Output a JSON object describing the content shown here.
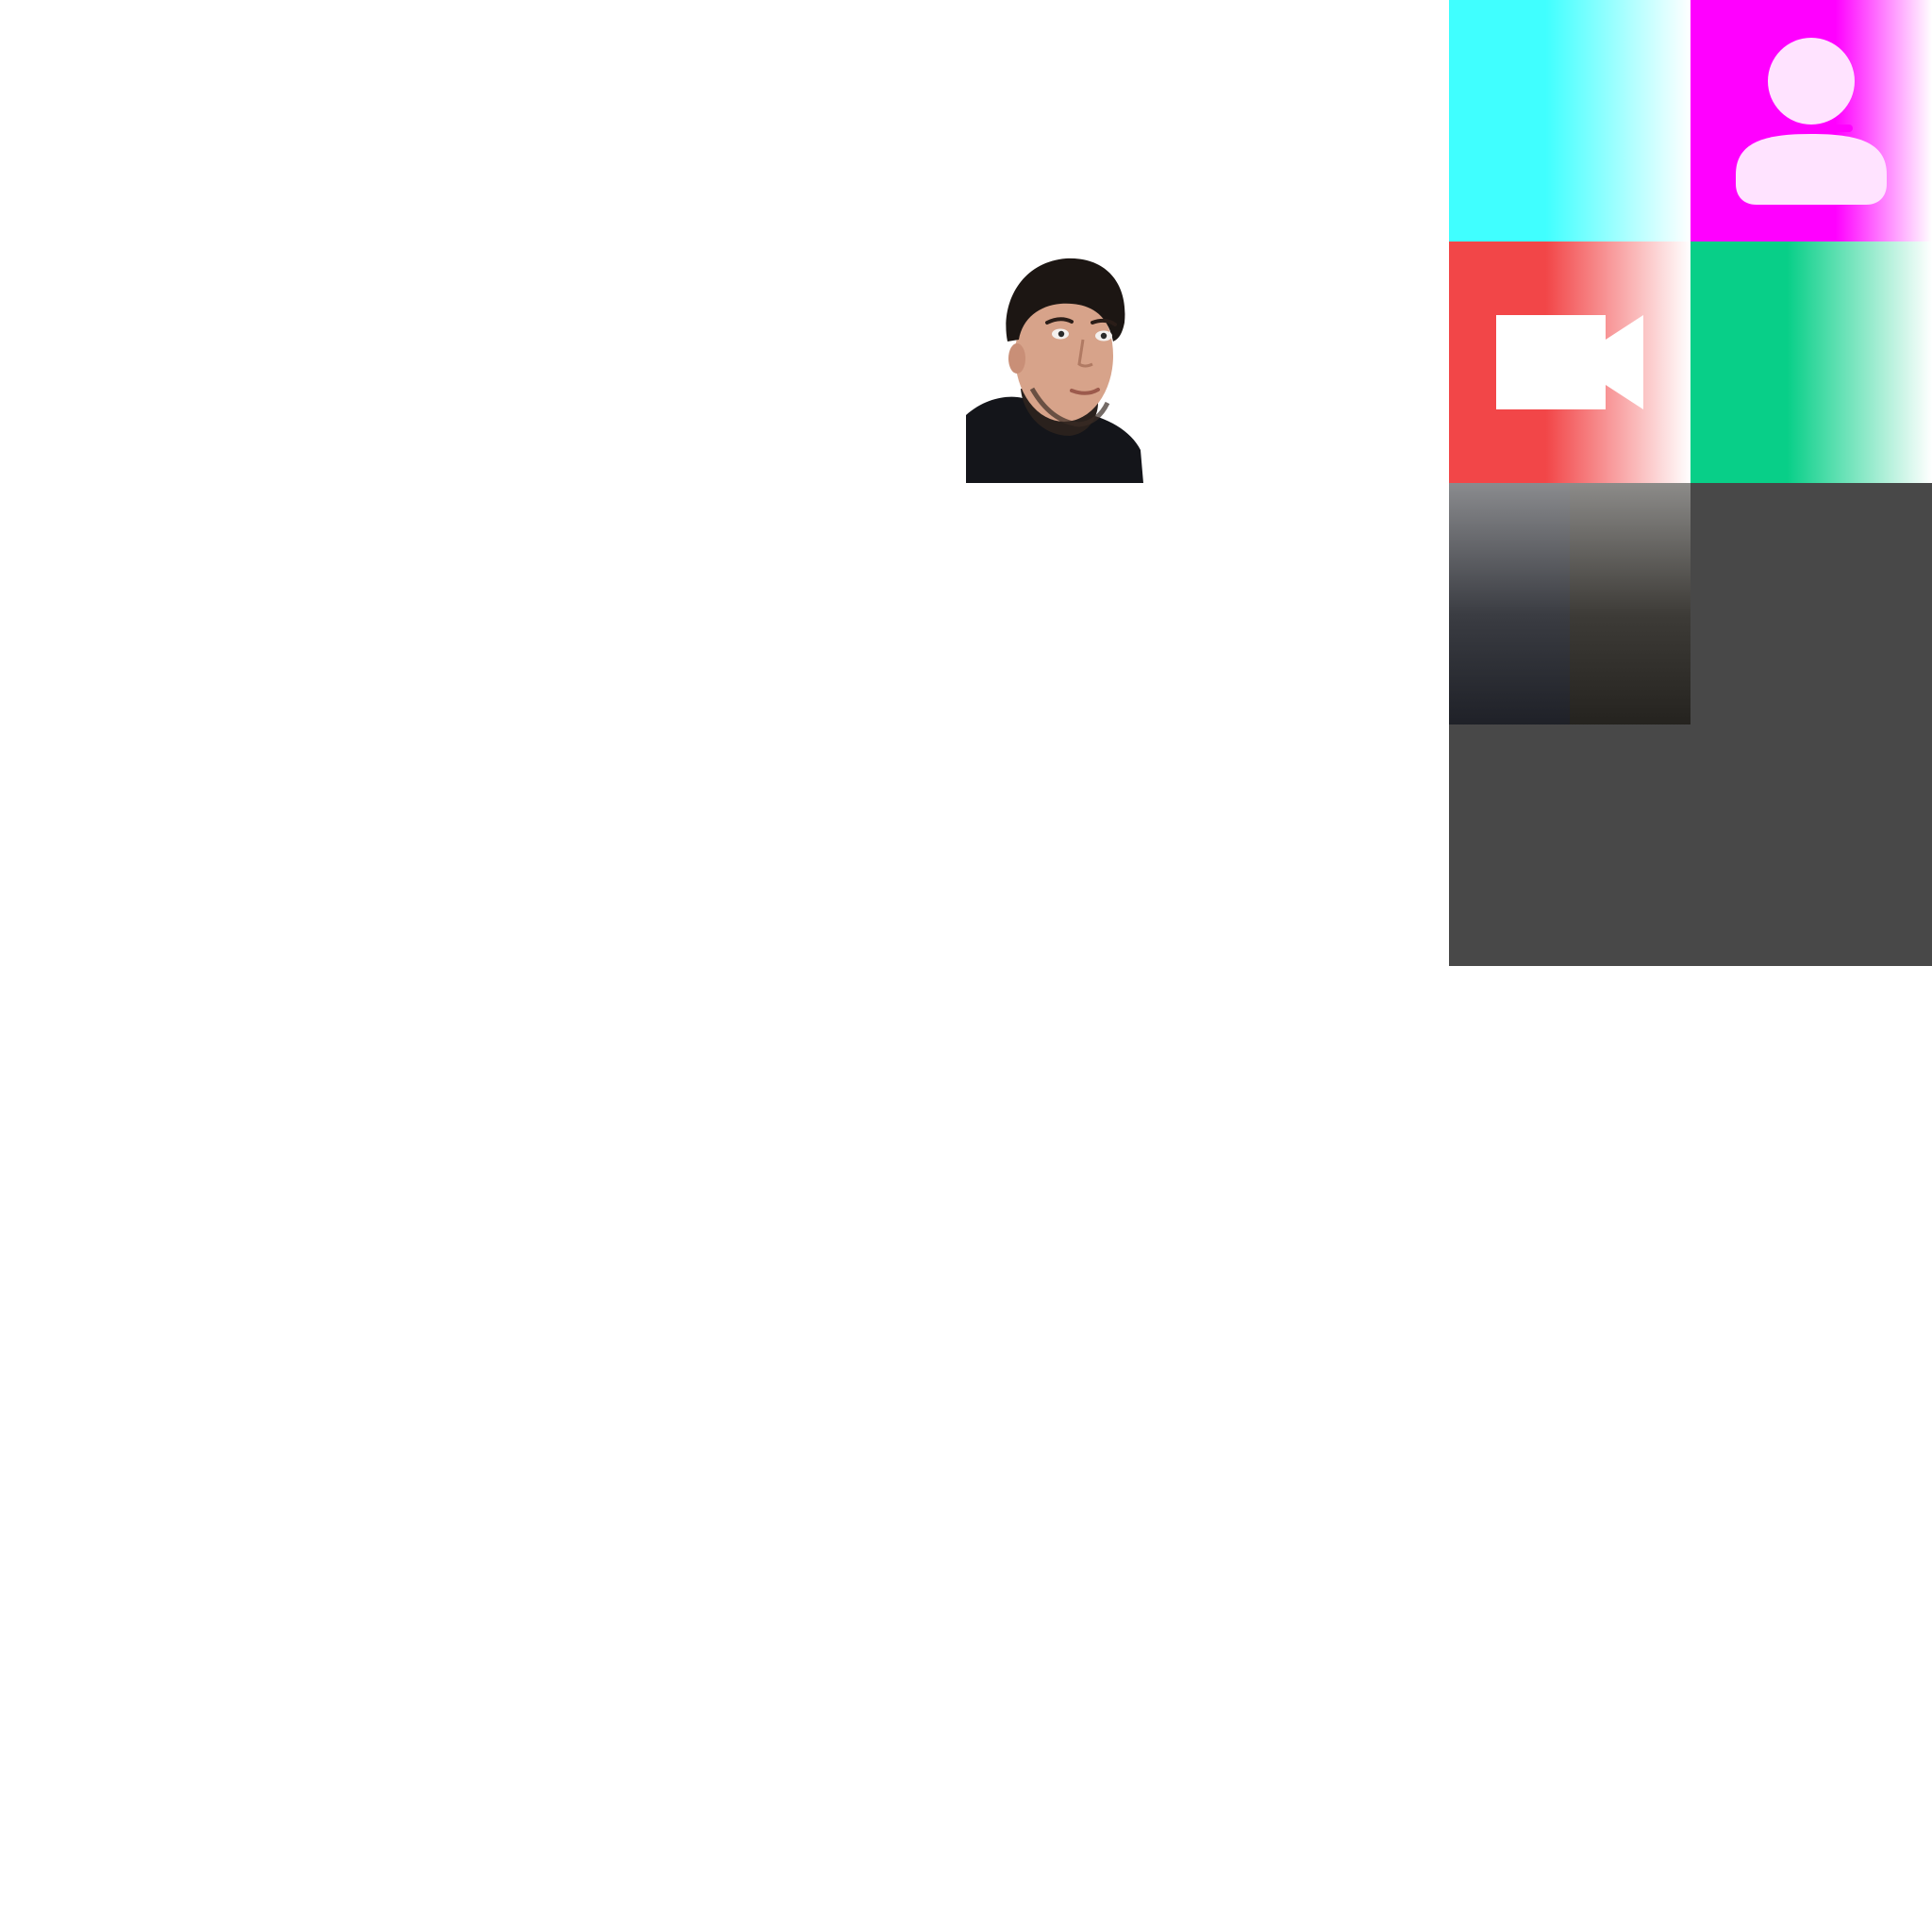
{
  "canvas": {
    "background": "#ffffff"
  },
  "portrait": {
    "icon": "person-photo",
    "colors": {
      "hair": "#1c1613",
      "skin": "#d7a38a",
      "shirt": "#14151a"
    }
  },
  "tiles": [
    {
      "name": "tile-cyan",
      "color": "#40ffff",
      "icon": null
    },
    {
      "name": "tile-magenta",
      "color": "#ff00ff",
      "icon": "user-icon"
    },
    {
      "name": "tile-red",
      "color": "#f24648",
      "icon": "video-camera-icon"
    },
    {
      "name": "tile-green",
      "color": "#08cf88",
      "icon": null
    },
    {
      "name": "tile-slate-a",
      "color": "#1f2128",
      "icon": null
    },
    {
      "name": "tile-slate-b",
      "color": "#25231f",
      "icon": null
    }
  ],
  "panels": [
    {
      "name": "panel-dark-right",
      "color": "#484848"
    },
    {
      "name": "panel-dark-bottom",
      "color": "#484848"
    }
  ]
}
